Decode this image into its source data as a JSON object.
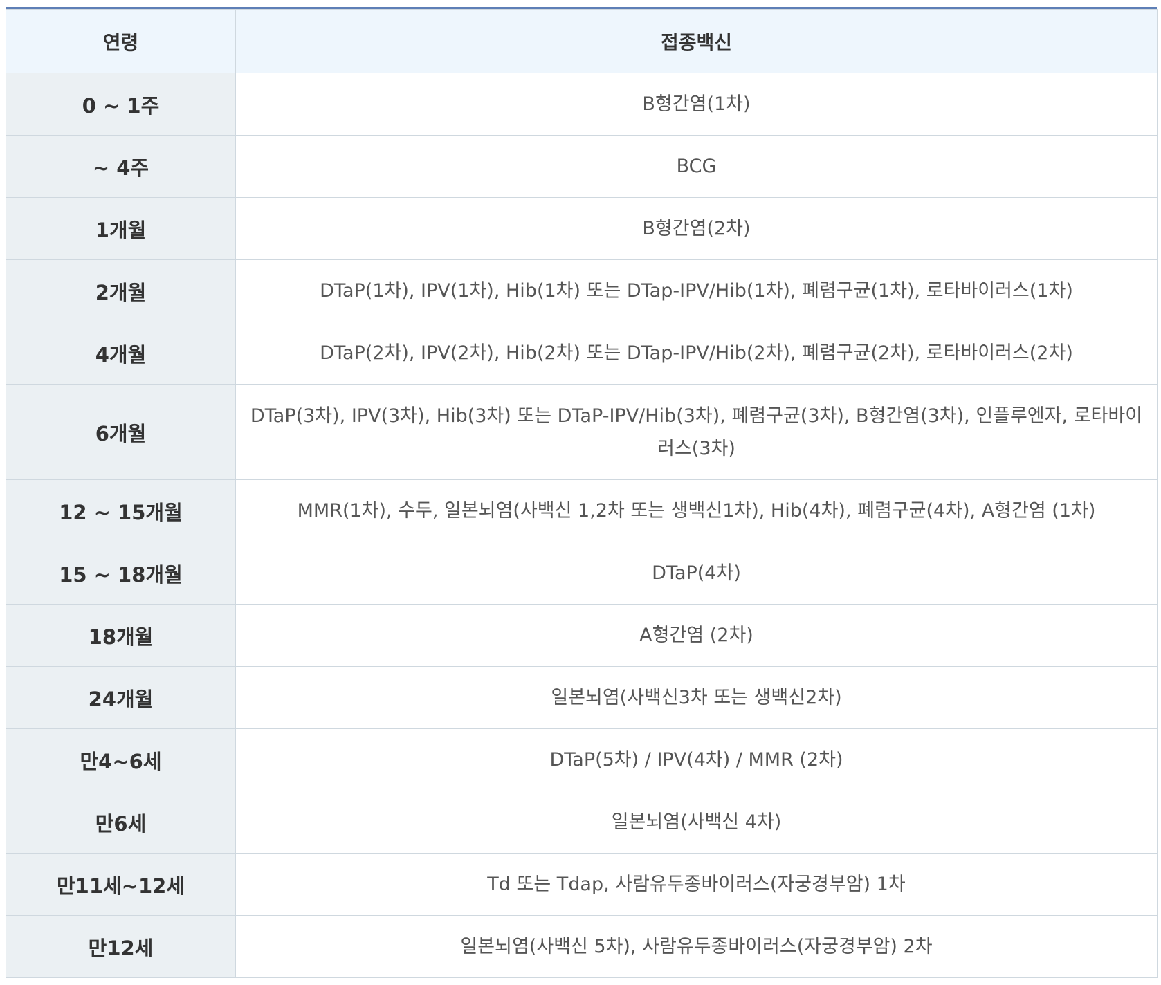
{
  "table": {
    "headers": {
      "age": "연령",
      "vaccine": "접종백신"
    },
    "rows": [
      {
        "age": "0 ~ 1주",
        "vaccine": "B형간염(1차)"
      },
      {
        "age": "~ 4주",
        "vaccine": "BCG"
      },
      {
        "age": "1개월",
        "vaccine": "B형간염(2차)"
      },
      {
        "age": "2개월",
        "vaccine": "DTaP(1차), IPV(1차), Hib(1차) 또는 DTap-IPV/Hib(1차), 폐렴구균(1차), 로타바이러스(1차)"
      },
      {
        "age": "4개월",
        "vaccine": "DTaP(2차), IPV(2차), Hib(2차) 또는 DTap-IPV/Hib(2차), 폐렴구균(2차), 로타바이러스(2차)"
      },
      {
        "age": "6개월",
        "vaccine": "DTaP(3차), IPV(3차), Hib(3차) 또는 DTaP-IPV/Hib(3차), 폐렴구균(3차), B형간염(3차), 인플루엔자, 로타바이러스(3차)"
      },
      {
        "age": "12 ~ 15개월",
        "vaccine": "MMR(1차), 수두, 일본뇌염(사백신 1,2차 또는 생백신1차), Hib(4차), 폐렴구균(4차), A형간염 (1차)"
      },
      {
        "age": "15 ~ 18개월",
        "vaccine": "DTaP(4차)"
      },
      {
        "age": "18개월",
        "vaccine": "A형간염 (2차)"
      },
      {
        "age": "24개월",
        "vaccine": "일본뇌염(사백신3차 또는 생백신2차)"
      },
      {
        "age": "만4~6세",
        "vaccine": "DTaP(5차) / IPV(4차) / MMR (2차)"
      },
      {
        "age": "만6세",
        "vaccine": "일본뇌염(사백신 4차)"
      },
      {
        "age": "만11세~12세",
        "vaccine": "Td 또는 Tdap, 사람유두종바이러스(자궁경부암) 1차"
      },
      {
        "age": "만12세",
        "vaccine": "일본뇌염(사백신 5차), 사람유두종바이러스(자궁경부암) 2차"
      }
    ]
  }
}
